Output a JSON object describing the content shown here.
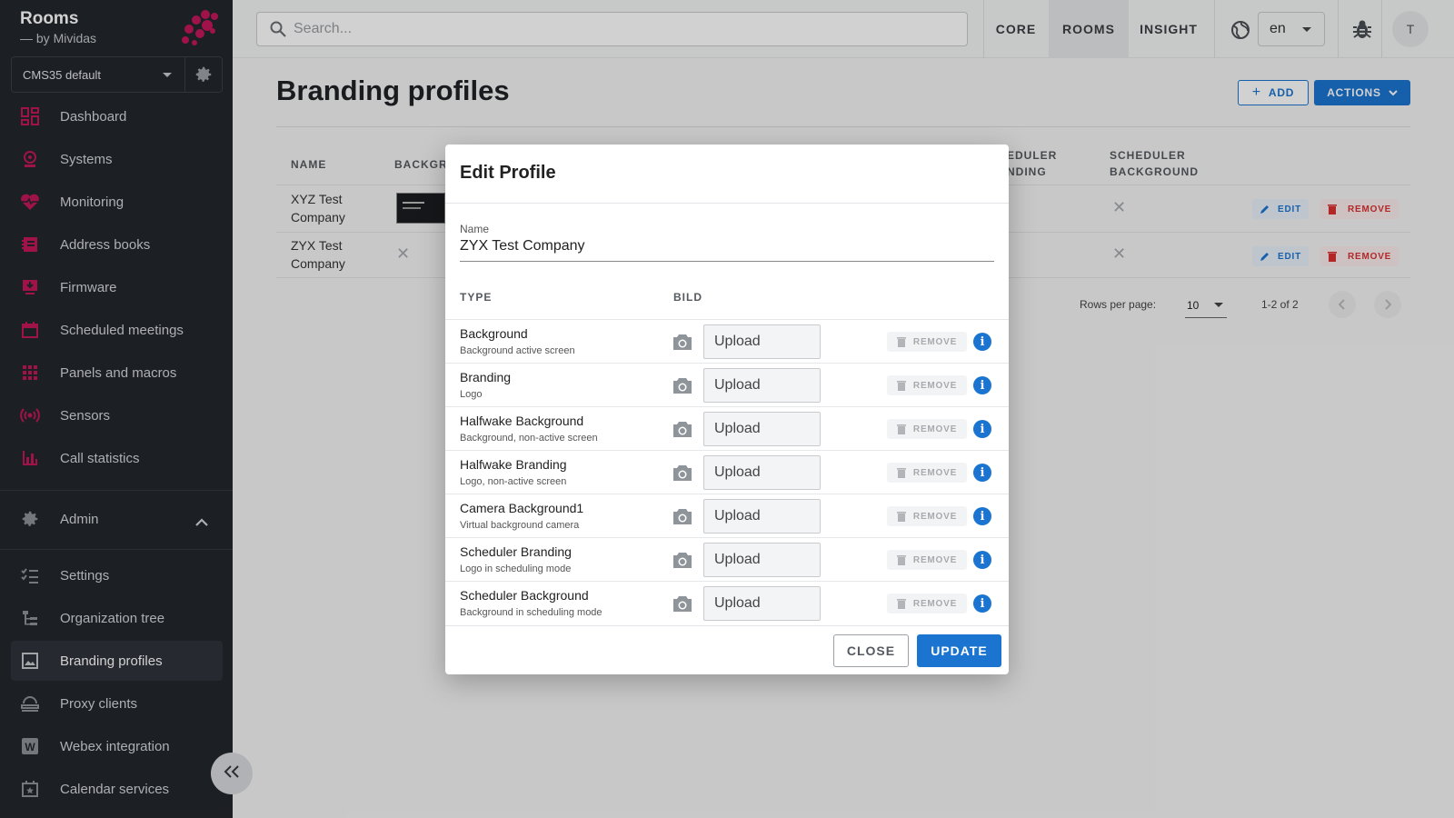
{
  "app": {
    "title": "Rooms",
    "subtitle": "— by Mividas"
  },
  "system_select": {
    "value": "CMS35 default"
  },
  "sidebar": {
    "items": [
      {
        "label": "Dashboard",
        "icon": "dashboard-icon"
      },
      {
        "label": "Systems",
        "icon": "systems-icon"
      },
      {
        "label": "Monitoring",
        "icon": "heart-pulse-icon"
      },
      {
        "label": "Address books",
        "icon": "address-book-icon"
      },
      {
        "label": "Firmware",
        "icon": "firmware-icon"
      },
      {
        "label": "Scheduled meetings",
        "icon": "calendar-icon"
      },
      {
        "label": "Panels and macros",
        "icon": "grid-icon"
      },
      {
        "label": "Sensors",
        "icon": "sensor-icon"
      },
      {
        "label": "Call statistics",
        "icon": "bar-chart-icon"
      }
    ],
    "admin_label": "Admin",
    "admin_items": [
      {
        "label": "Settings",
        "icon": "settings-list-icon"
      },
      {
        "label": "Organization tree",
        "icon": "tree-icon"
      },
      {
        "label": "Branding profiles",
        "icon": "image-icon",
        "active": true
      },
      {
        "label": "Proxy clients",
        "icon": "proxy-icon"
      },
      {
        "label": "Webex integration",
        "icon": "webex-icon"
      },
      {
        "label": "Calendar services",
        "icon": "calendar-star-icon"
      }
    ]
  },
  "topbar": {
    "search_placeholder": "Search...",
    "tabs": [
      "CORE",
      "ROOMS",
      "INSIGHT"
    ],
    "active_tab": "ROOMS",
    "language": "en",
    "avatar": "T"
  },
  "page": {
    "title": "Branding profiles",
    "add_label": "ADD",
    "actions_label": "ACTIONS",
    "table": {
      "headers": {
        "name": "NAME",
        "background": "BACKGRO",
        "sched_branding_1": "EDULER",
        "sched_branding_2": "NDING",
        "sched_bg_1": "SCHEDULER",
        "sched_bg_2": "BACKGROUND"
      },
      "rows": [
        {
          "name_1": "XYZ Test",
          "name_2": "Company",
          "edit": "EDIT",
          "remove": "REMOVE"
        },
        {
          "name_1": "ZYX Test",
          "name_2": "Company",
          "edit": "EDIT",
          "remove": "REMOVE"
        }
      ]
    },
    "pager": {
      "rows_label": "Rows per page:",
      "rows_value": "10",
      "range": "1-2 of 2"
    }
  },
  "modal": {
    "title": "Edit Profile",
    "name_label": "Name",
    "name_value": "ZYX Test Company",
    "col_type": "TYPE",
    "col_image": "BILD",
    "upload_label": "Upload",
    "remove_label": "REMOVE",
    "rows": [
      {
        "type": "Background",
        "desc": "Background active screen"
      },
      {
        "type": "Branding",
        "desc": "Logo"
      },
      {
        "type": "Halfwake Background",
        "desc": "Background, non-active screen"
      },
      {
        "type": "Halfwake Branding",
        "desc": "Logo, non-active screen"
      },
      {
        "type": "Camera Background1",
        "desc": "Virtual background camera"
      },
      {
        "type": "Scheduler Branding",
        "desc": "Logo in scheduling mode"
      },
      {
        "type": "Scheduler Background",
        "desc": "Background in scheduling mode"
      }
    ],
    "close_label": "CLOSE",
    "update_label": "UPDATE"
  },
  "colors": {
    "accent": "#1b75d0",
    "brand": "#c2185b",
    "sidebar_bg": "#23262b",
    "danger": "#d93030"
  }
}
